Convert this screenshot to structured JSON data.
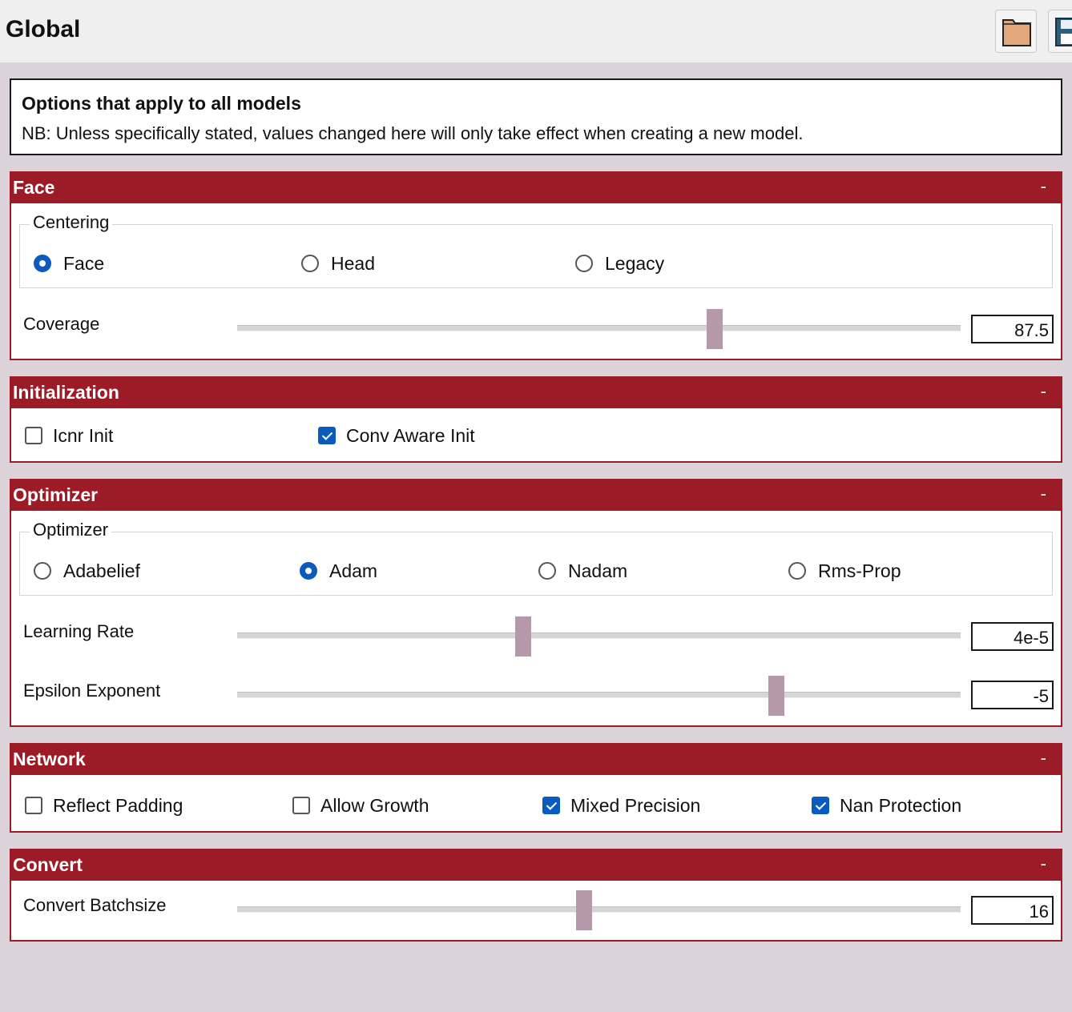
{
  "header": {
    "title": "Global",
    "buttons": [
      {
        "icon": "folder-icon"
      },
      {
        "icon": "save-icon"
      }
    ]
  },
  "info": {
    "heading": "Options that apply to all models",
    "text": "NB: Unless specifically stated, values changed here will only take effect when creating a new model."
  },
  "collapse_symbol": "-",
  "colors": {
    "section": "#9b1c26",
    "accent": "#0a5bbd",
    "thumb": "#b599ab"
  },
  "face": {
    "title": "Face",
    "centering": {
      "legend": "Centering",
      "options": [
        "Face",
        "Head",
        "Legacy"
      ],
      "selected": "Face"
    },
    "coverage": {
      "label": "Coverage",
      "value": "87.5",
      "position": 0.66
    }
  },
  "initialization": {
    "title": "Initialization",
    "options": [
      {
        "label": "Icnr Init",
        "checked": false
      },
      {
        "label": "Conv Aware Init",
        "checked": true
      }
    ]
  },
  "optimizer": {
    "title": "Optimizer",
    "group": {
      "legend": "Optimizer",
      "options": [
        "Adabelief",
        "Adam",
        "Nadam",
        "Rms-Prop"
      ],
      "selected": "Adam"
    },
    "learning_rate": {
      "label": "Learning Rate",
      "value": "4e-5",
      "position": 0.395
    },
    "epsilon": {
      "label": "Epsilon Exponent",
      "value": "-5",
      "position": 0.745
    }
  },
  "network": {
    "title": "Network",
    "options": [
      {
        "label": "Reflect Padding",
        "checked": false
      },
      {
        "label": "Allow Growth",
        "checked": false
      },
      {
        "label": "Mixed Precision",
        "checked": true
      },
      {
        "label": "Nan Protection",
        "checked": true
      }
    ]
  },
  "convert": {
    "title": "Convert",
    "batchsize": {
      "label": "Convert Batchsize",
      "value": "16",
      "position": 0.48
    }
  }
}
